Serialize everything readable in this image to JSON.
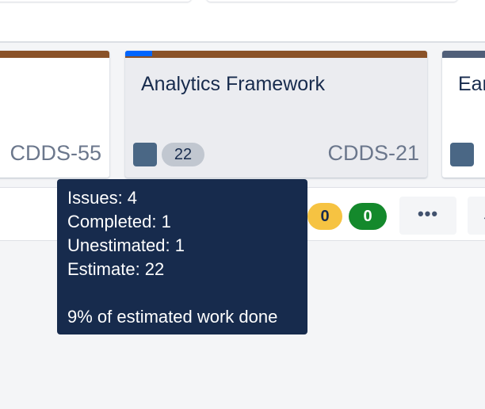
{
  "cards": [
    {
      "key": "CDDS-55"
    },
    {
      "title": "Analytics Framework",
      "key": "CDDS-21",
      "estimate": "22",
      "progress_fraction": 0.09
    },
    {
      "title_partial": "Ear"
    }
  ],
  "lane": {
    "counts": [
      {
        "value": "0"
      },
      {
        "value": "0"
      }
    ],
    "more_label": "•••"
  },
  "tooltip": {
    "issues": "Issues: 4",
    "completed": "Completed: 1",
    "unestimated": "Unestimated: 1",
    "estimate": "Estimate: 22",
    "summary": "9% of estimated work done"
  },
  "colors": {
    "epic_brown": "#8a5228",
    "epic_slate": "#505f79",
    "progress_blue": "#0065ff",
    "tooltip_bg": "#172b4d",
    "count_amber": "#f6c342",
    "count_green": "#14892c"
  }
}
